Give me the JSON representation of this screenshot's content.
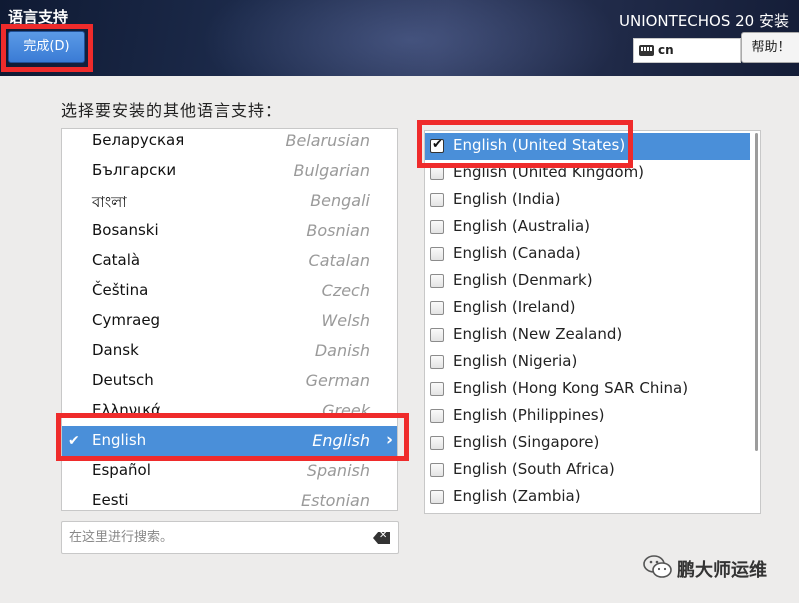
{
  "header": {
    "page_title": "语言支持",
    "product_title": "UNIONTECHOS 20 安装",
    "done_label": "完成(D)",
    "keyboard_layout": "cn",
    "help_label": "帮助！"
  },
  "section_label": "选择要安装的其他语言支持：",
  "languages": [
    {
      "native": "Беларуская",
      "english": "Belarusian"
    },
    {
      "native": "Български",
      "english": "Bulgarian"
    },
    {
      "native": "বাংলা",
      "english": "Bengali"
    },
    {
      "native": "Bosanski",
      "english": "Bosnian"
    },
    {
      "native": "Català",
      "english": "Catalan"
    },
    {
      "native": "Čeština",
      "english": "Czech"
    },
    {
      "native": "Cymraeg",
      "english": "Welsh"
    },
    {
      "native": "Dansk",
      "english": "Danish"
    },
    {
      "native": "Deutsch",
      "english": "German"
    },
    {
      "native": "Ελληνικά",
      "english": "Greek"
    },
    {
      "native": "English",
      "english": "English",
      "selected": true
    },
    {
      "native": "Español",
      "english": "Spanish"
    },
    {
      "native": "Eesti",
      "english": "Estonian"
    }
  ],
  "locales": [
    {
      "label": "English (United States)",
      "checked": true,
      "selected": true
    },
    {
      "label": "English (United Kingdom)",
      "checked": false
    },
    {
      "label": "English (India)",
      "checked": false
    },
    {
      "label": "English (Australia)",
      "checked": false
    },
    {
      "label": "English (Canada)",
      "checked": false
    },
    {
      "label": "English (Denmark)",
      "checked": false
    },
    {
      "label": "English (Ireland)",
      "checked": false
    },
    {
      "label": "English (New Zealand)",
      "checked": false
    },
    {
      "label": "English (Nigeria)",
      "checked": false
    },
    {
      "label": "English (Hong Kong SAR China)",
      "checked": false
    },
    {
      "label": "English (Philippines)",
      "checked": false
    },
    {
      "label": "English (Singapore)",
      "checked": false
    },
    {
      "label": "English (South Africa)",
      "checked": false
    },
    {
      "label": "English (Zambia)",
      "checked": false
    }
  ],
  "search": {
    "placeholder": "在这里进行搜索。"
  },
  "watermark": "鹏大师运维",
  "colors": {
    "selection": "#4a8fd9",
    "highlight": "#ef2b2b",
    "done_button": "#3a7bd5"
  }
}
